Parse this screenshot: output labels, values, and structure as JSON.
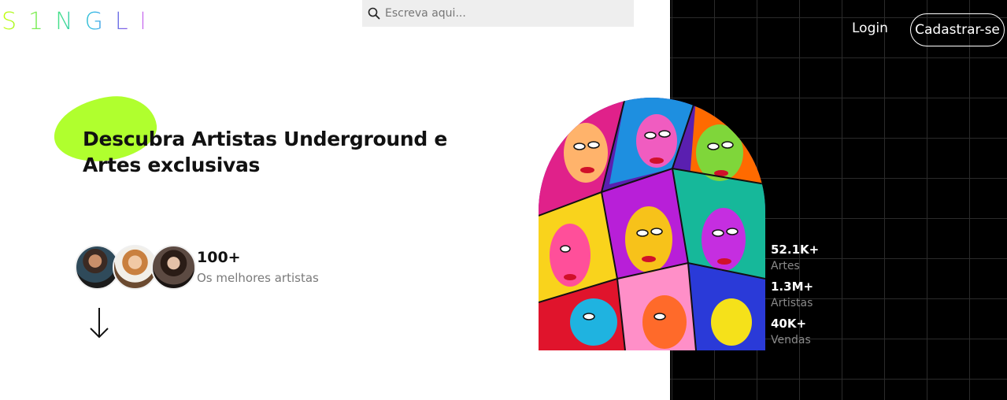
{
  "header": {
    "logo": "S1NGLE",
    "search_placeholder": "Escreva aqui...",
    "login_label": "Login",
    "signup_label": "Cadastrar-se"
  },
  "hero": {
    "headline_part1": "Descubra ",
    "headline_bold1": "Artistas Underground",
    "headline_part2": " e",
    "headline_bold2": "Artes exclusivas"
  },
  "artists": {
    "count": "100+",
    "label": "Os melhores artistas"
  },
  "stats": [
    {
      "value": "52.1K+",
      "label": "Artes"
    },
    {
      "value": "1.3M+",
      "label": "Artistas"
    },
    {
      "value": "40K+",
      "label": "Vendas"
    }
  ],
  "colors": {
    "accent_lime": "#b0ff2e",
    "dark_bg": "#000000",
    "search_bg": "#eeeeee"
  },
  "icons": {
    "search": "search-icon",
    "arrow": "arrow-down-icon"
  }
}
